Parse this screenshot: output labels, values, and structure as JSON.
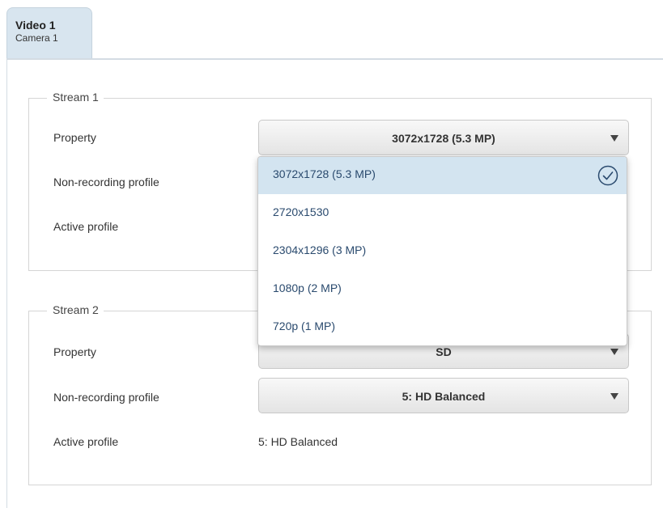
{
  "tab": {
    "title": "Video 1",
    "subtitle": "Camera 1"
  },
  "stream1": {
    "legend": "Stream 1",
    "property_label": "Property",
    "property_value": "3072x1728 (5.3 MP)",
    "nonrec_label": "Non-recording profile",
    "active_label": "Active profile"
  },
  "dropdown": {
    "options": [
      "3072x1728 (5.3 MP)",
      "2720x1530",
      "2304x1296 (3 MP)",
      "1080p (2 MP)",
      "720p (1 MP)"
    ],
    "selected_index": 0
  },
  "stream2": {
    "legend": "Stream 2",
    "property_label": "Property",
    "property_value": "SD",
    "nonrec_label": "Non-recording profile",
    "nonrec_value": "5: HD Balanced",
    "active_label": "Active profile",
    "active_value": "5: HD Balanced"
  },
  "colors": {
    "tab_bg": "#d8e5ef",
    "selected_option_bg": "#d3e4f0",
    "option_text": "#2a4a6e"
  },
  "icons": {
    "dropdown_arrow": "triangle-down",
    "selected_mark": "check-circle"
  }
}
